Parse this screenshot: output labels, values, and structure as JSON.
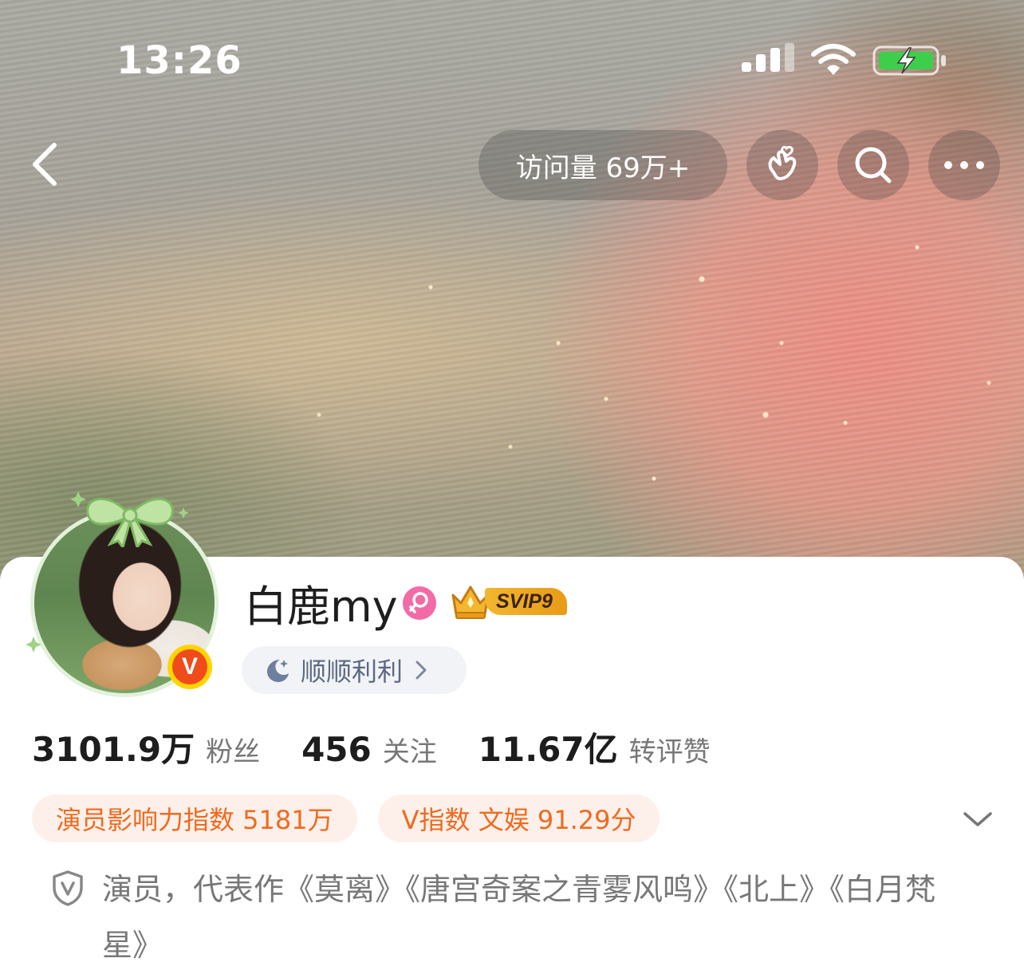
{
  "status_bar": {
    "time": "13:26"
  },
  "nav": {
    "visits_label": "访问量 69万+"
  },
  "profile": {
    "name": "白鹿my",
    "vip_badge": "SVIP9",
    "mood": "顺顺利利",
    "verified_mark": "V"
  },
  "stats": [
    {
      "value": "3101.9万",
      "label": "粉丝"
    },
    {
      "value": "456",
      "label": "关注"
    },
    {
      "value": "11.67亿",
      "label": "转评赞"
    }
  ],
  "tags": [
    {
      "label": "演员影响力指数 5181万"
    },
    {
      "label": "V指数 文娱 91.29分"
    }
  ],
  "verification": {
    "text": "演员，代表作《莫离》《唐宫奇案之青雾风鸣》《北上》《白月梵星》"
  },
  "colors": {
    "accent_orange": "#f06a1e",
    "tag_bg": "#fdf0ea",
    "gender_pink": "#f26ba6",
    "svip_gold": "#f2b630",
    "battery_green": "#3dcf4b"
  },
  "icons": {
    "back": "chevron-left-icon",
    "greeting": "hand-heart-icon",
    "search": "search-icon",
    "more": "more-icon",
    "gender": "female-icon",
    "mood": "moon-icon",
    "expand": "chevron-down-icon",
    "verify": "shield-v-icon"
  }
}
